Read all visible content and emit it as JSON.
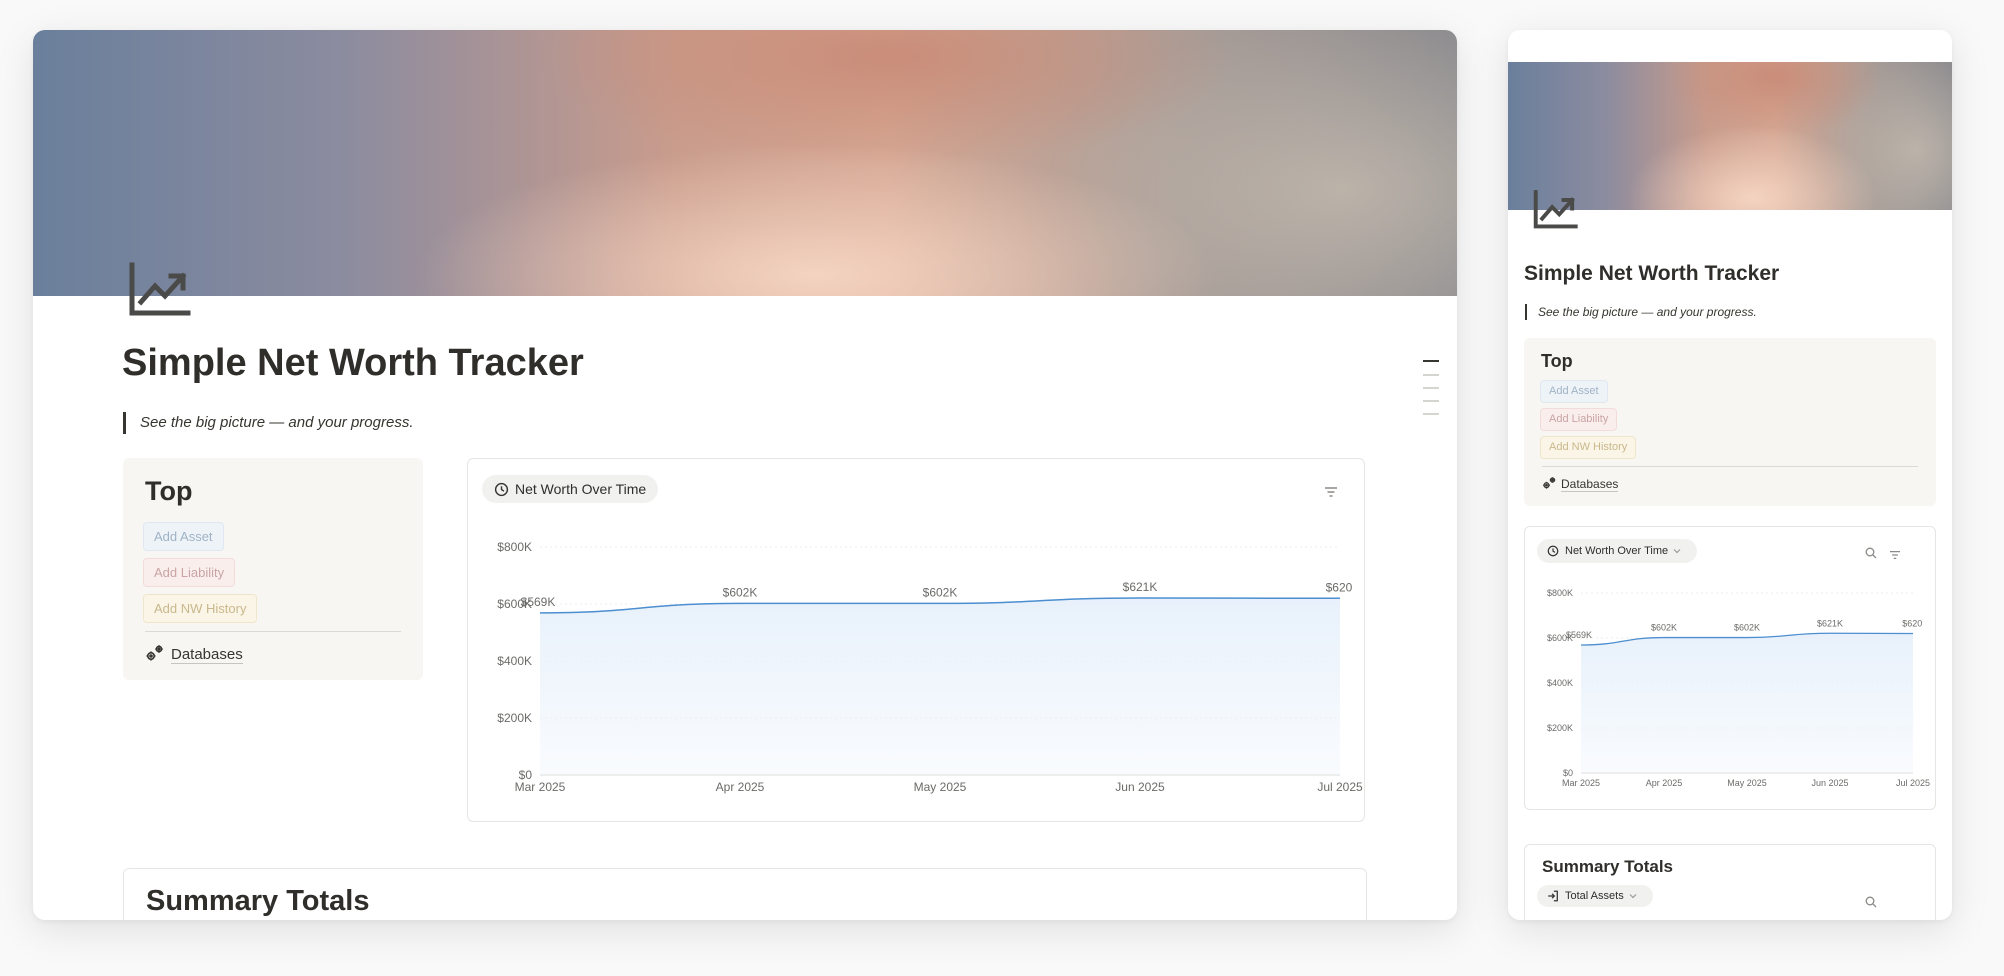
{
  "page": {
    "title": "Simple Net Worth Tracker",
    "quote": "See the big picture — and your progress.",
    "icon": "trending-up-chart-icon"
  },
  "top_section": {
    "heading": "Top",
    "buttons": [
      {
        "label": "Add Asset",
        "color": "blue"
      },
      {
        "label": "Add Liability",
        "color": "red"
      },
      {
        "label": "Add NW History",
        "color": "yellow"
      }
    ],
    "databases_link": "Databases",
    "databases_icon": "gears-icon"
  },
  "chart_view": {
    "label": "Net Worth Over Time",
    "view_icon": "clock-icon",
    "filter_icon": "filter-icon",
    "search_icon": "search-icon"
  },
  "chart_data": {
    "type": "area",
    "x": [
      "Mar 2025",
      "Apr 2025",
      "May 2025",
      "Jun 2025",
      "Jul 2025"
    ],
    "point_labels": [
      "$569K",
      "$602K",
      "$602K",
      "$621K",
      "$620"
    ],
    "values": [
      569,
      602,
      602,
      621,
      620
    ],
    "ylim": [
      0,
      800
    ],
    "yticks": [
      "$0",
      "$200K",
      "$400K",
      "$600K",
      "$800K"
    ],
    "ytick_values": [
      0,
      200,
      400,
      600,
      800
    ],
    "grid": true,
    "line_color": "#4c8ed0",
    "fill_color": "#e8f1fb"
  },
  "summary": {
    "title": "Summary Totals",
    "view_chip": "Total Assets",
    "view_icon": "login-icon"
  }
}
